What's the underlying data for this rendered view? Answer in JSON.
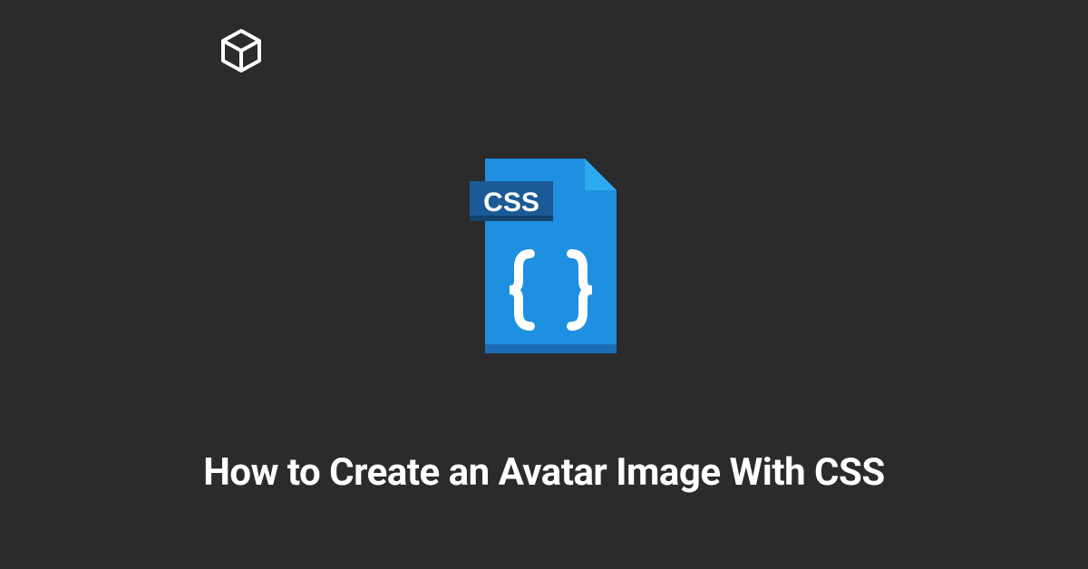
{
  "logo": {
    "name": "cube-logo"
  },
  "illustration": {
    "label": "CSS",
    "name": "css-file-icon"
  },
  "title": "How to Create an Avatar Image With CSS",
  "colors": {
    "background": "#2b2b2b",
    "text": "#ffffff",
    "file_body": "#1e8fe1",
    "file_corner": "#2da9f0",
    "label_bg": "#1a5a96",
    "brace_color": "#ffffff"
  }
}
